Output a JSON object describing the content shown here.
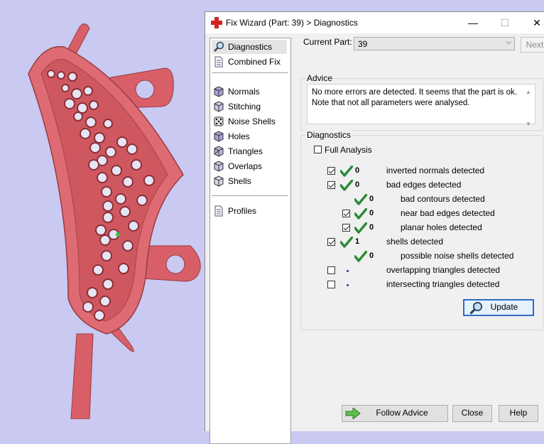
{
  "window": {
    "title": "Fix Wizard (Part: 39) > Diagnostics",
    "controls": {
      "minimize": "—",
      "maximize": "☐",
      "close": "✕"
    }
  },
  "sidebar": {
    "items": [
      {
        "label": "Diagnostics",
        "icon": "magnifier-icon"
      },
      {
        "label": "Combined Fix",
        "icon": "document-icon"
      },
      {
        "label": "Normals",
        "icon": "cube-icon"
      },
      {
        "label": "Stitching",
        "icon": "cube-icon"
      },
      {
        "label": "Noise Shells",
        "icon": "dice-icon"
      },
      {
        "label": "Holes",
        "icon": "cube-icon"
      },
      {
        "label": "Triangles",
        "icon": "cube-icon"
      },
      {
        "label": "Overlaps",
        "icon": "cube-icon"
      },
      {
        "label": "Shells",
        "icon": "cube-icon"
      },
      {
        "label": "Profiles",
        "icon": "document-icon"
      }
    ]
  },
  "current_part": {
    "label": "Current Part:",
    "value": "39",
    "next_label": "Next"
  },
  "advice": {
    "title": "Advice",
    "line1": "No more errors are detected. It seems that the part is ok.",
    "line2": "Note that not all parameters were analysed."
  },
  "diagnostics": {
    "title": "Diagnostics",
    "full_analysis_label": "Full Analysis",
    "rows": [
      {
        "count": "0",
        "label": "inverted normals detected",
        "checked": true,
        "status": "ok"
      },
      {
        "count": "0",
        "label": "bad edges detected",
        "checked": true,
        "status": "ok"
      },
      {
        "count": "0",
        "label": "bad contours detected",
        "checked": null,
        "status": "ok"
      },
      {
        "count": "0",
        "label": "near bad edges detected",
        "checked": true,
        "status": "ok"
      },
      {
        "count": "0",
        "label": "planar holes detected",
        "checked": true,
        "status": "ok"
      },
      {
        "count": "1",
        "label": "shells detected",
        "checked": true,
        "status": "ok"
      },
      {
        "count": "0",
        "label": "possible noise shells detected",
        "checked": null,
        "status": "ok"
      },
      {
        "count": "",
        "label": "overlapping triangles detected",
        "checked": false,
        "status": "none"
      },
      {
        "count": "",
        "label": "intersecting triangles detected",
        "checked": false,
        "status": "none"
      }
    ],
    "update_label": "Update"
  },
  "footer": {
    "follow_advice": "Follow Advice",
    "close": "Close",
    "help": "Help"
  },
  "colors": {
    "viewport_bg": "#c9c9f2",
    "model": "#d9646c",
    "check": "#2e8b3a",
    "default_button_border": "#2c6ecb"
  }
}
